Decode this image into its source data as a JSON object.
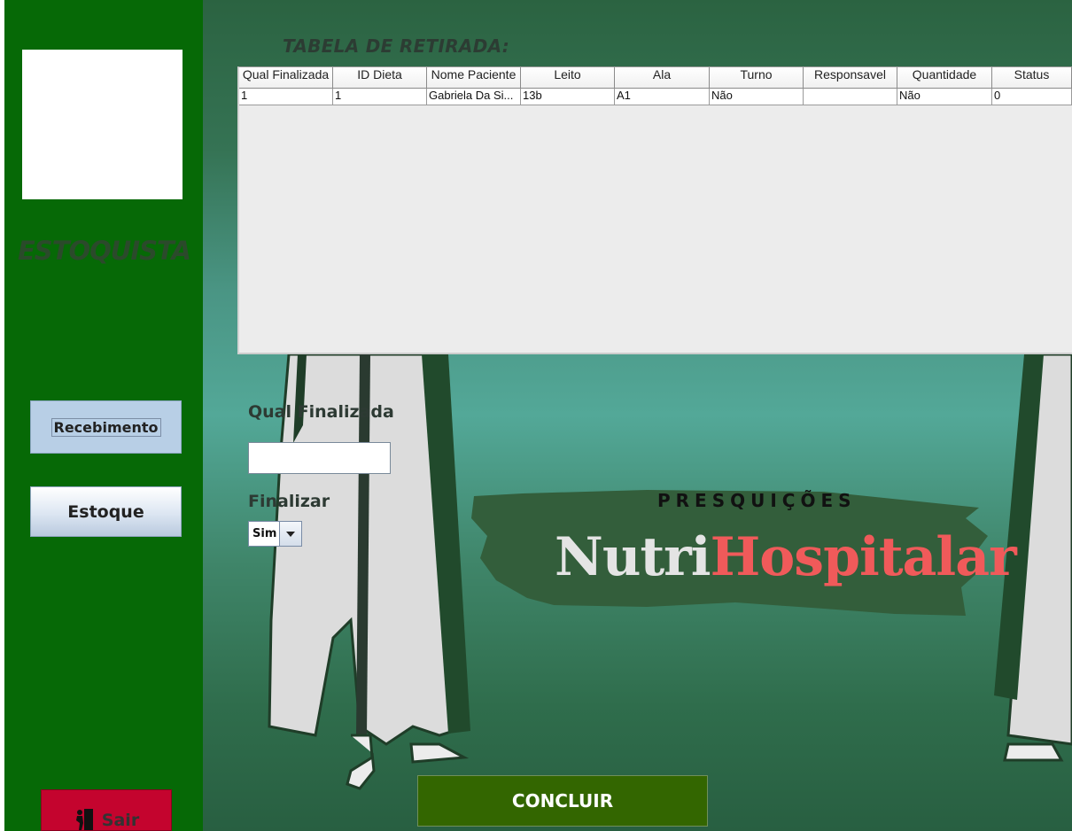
{
  "sidebar": {
    "role_label": "ESTOQUISTA",
    "recebimento_label": "Recebimento",
    "estoque_label": "Estoque",
    "sair_label": "Sair"
  },
  "table": {
    "title": "TABELA DE RETIRADA:",
    "columns": [
      "Qual Finalizada",
      "ID Dieta",
      "Nome Paciente",
      "Leito",
      "Ala",
      "Turno",
      "Responsavel",
      "Quantidade",
      "Status"
    ],
    "rows": [
      [
        "1",
        "1",
        "Gabriela Da Si...",
        "13b",
        "A1",
        "Não",
        "",
        "Não",
        "0"
      ]
    ]
  },
  "form": {
    "qual_label": "Qual Finalizada",
    "qual_value": "",
    "finalizar_label": "Finalizar",
    "finalizar_value": "Sim"
  },
  "brand": {
    "tagline": "PRESQUIÇÕES",
    "name_part1": "Nutri",
    "name_part2": "Hospitalar"
  },
  "actions": {
    "concluir_label": "CONCLUIR"
  },
  "colors": {
    "sidebar": "#066906",
    "concluir": "#336600",
    "sair": "#c4042e",
    "brand_accent": "#f05a5a"
  }
}
